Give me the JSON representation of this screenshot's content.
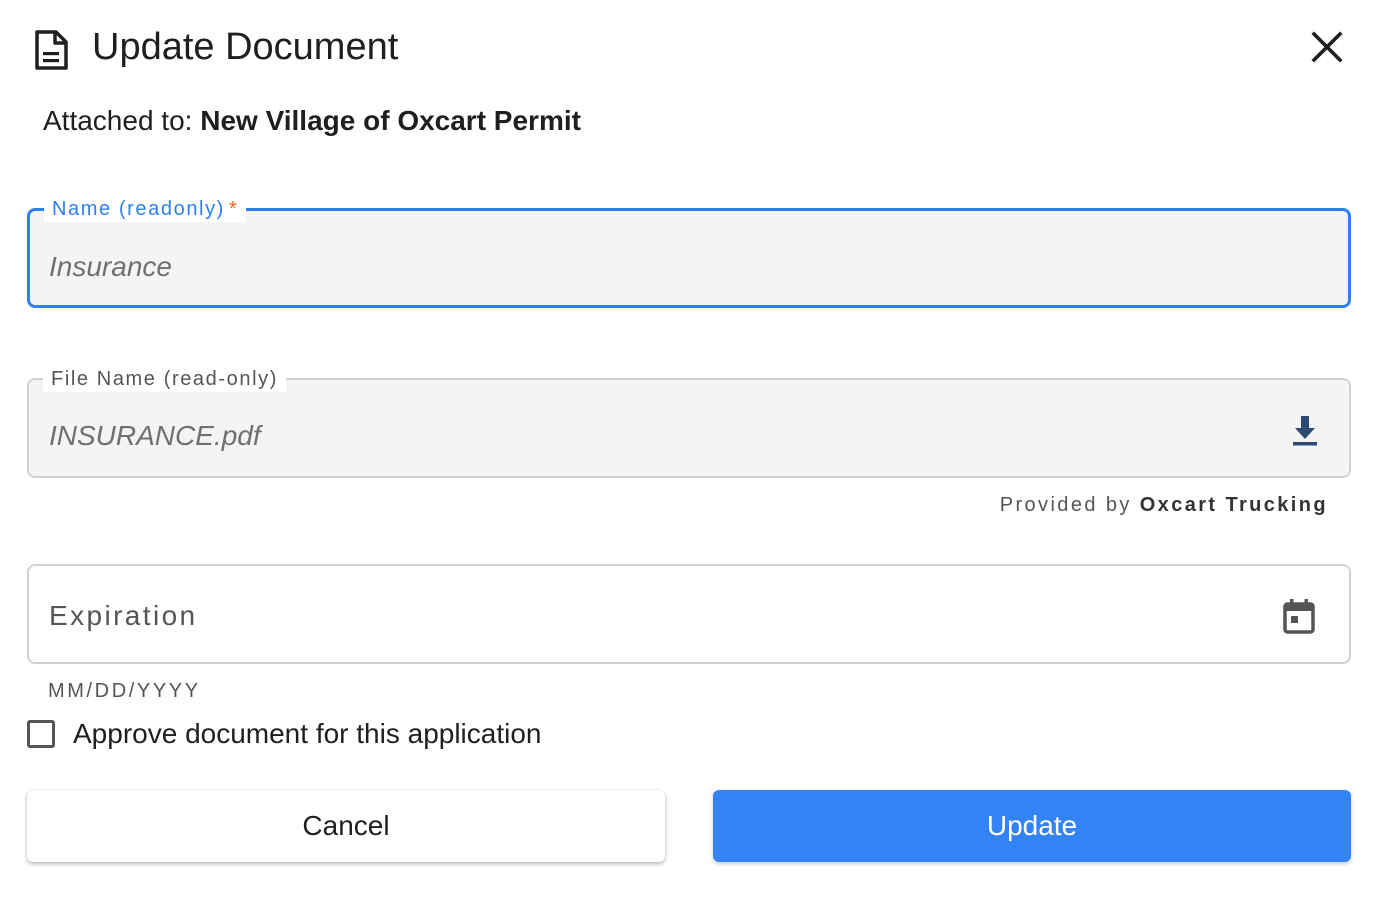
{
  "dialog": {
    "title": "Update Document",
    "title_icon": "document-icon",
    "close_icon": "close-icon",
    "attached_prefix": "Attached to:",
    "attached_target": "New Village of Oxcart Permit"
  },
  "form": {
    "name_field": {
      "label": "Name (readonly)",
      "required_mark": "*",
      "value": "Insurance"
    },
    "file_field": {
      "label": "File Name (read-only)",
      "value": "INSURANCE.pdf",
      "action_icon": "download-icon"
    },
    "provided": {
      "prefix": "Provided by",
      "provider": "Oxcart Trucking"
    },
    "expiration_field": {
      "label": "Expiration",
      "hint": "MM/DD/YYYY",
      "action_icon": "calendar-icon"
    },
    "approve": {
      "label": "Approve document for this application",
      "checked": false
    }
  },
  "actions": {
    "cancel_label": "Cancel",
    "update_label": "Update"
  },
  "colors": {
    "accent": "#2f80ed",
    "primary_button": "#3483f5",
    "required": "#e86b1f",
    "field_background": "#f4f4f4",
    "download_icon": "#2d4a73"
  }
}
